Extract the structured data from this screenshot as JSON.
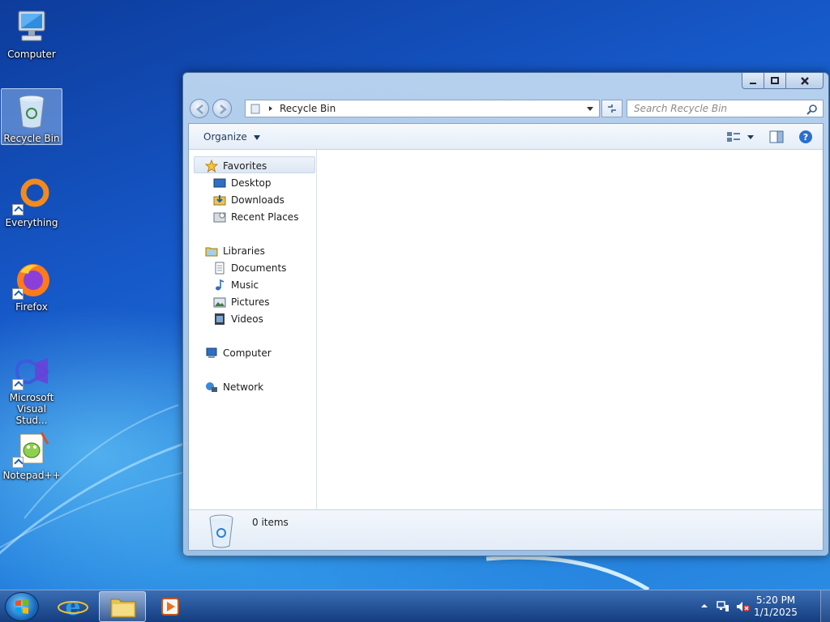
{
  "desktop": {
    "icons": [
      {
        "label": "Computer"
      },
      {
        "label": "Recycle Bin"
      },
      {
        "label": "Everything"
      },
      {
        "label": "Firefox"
      },
      {
        "label": "Microsoft Visual Stud..."
      },
      {
        "label": "Notepad++"
      }
    ]
  },
  "window": {
    "address": {
      "path": "Recycle Bin"
    },
    "search": {
      "placeholder": "Search Recycle Bin"
    },
    "toolbar": {
      "organize_label": "Organize"
    },
    "nav": {
      "favorites": {
        "label": "Favorites",
        "items": [
          {
            "label": "Desktop"
          },
          {
            "label": "Downloads"
          },
          {
            "label": "Recent Places"
          }
        ]
      },
      "libraries": {
        "label": "Libraries",
        "items": [
          {
            "label": "Documents"
          },
          {
            "label": "Music"
          },
          {
            "label": "Pictures"
          },
          {
            "label": "Videos"
          }
        ]
      },
      "computer": {
        "label": "Computer"
      },
      "network": {
        "label": "Network"
      }
    },
    "status": {
      "item_count": "0 items"
    }
  },
  "taskbar": {
    "clock": {
      "time": "5:20 PM",
      "date": "1/1/2025"
    }
  },
  "colors": {
    "accent": "#1b5fc4",
    "window_frame": "#b9d3ef",
    "close_button": "#c45a45"
  }
}
